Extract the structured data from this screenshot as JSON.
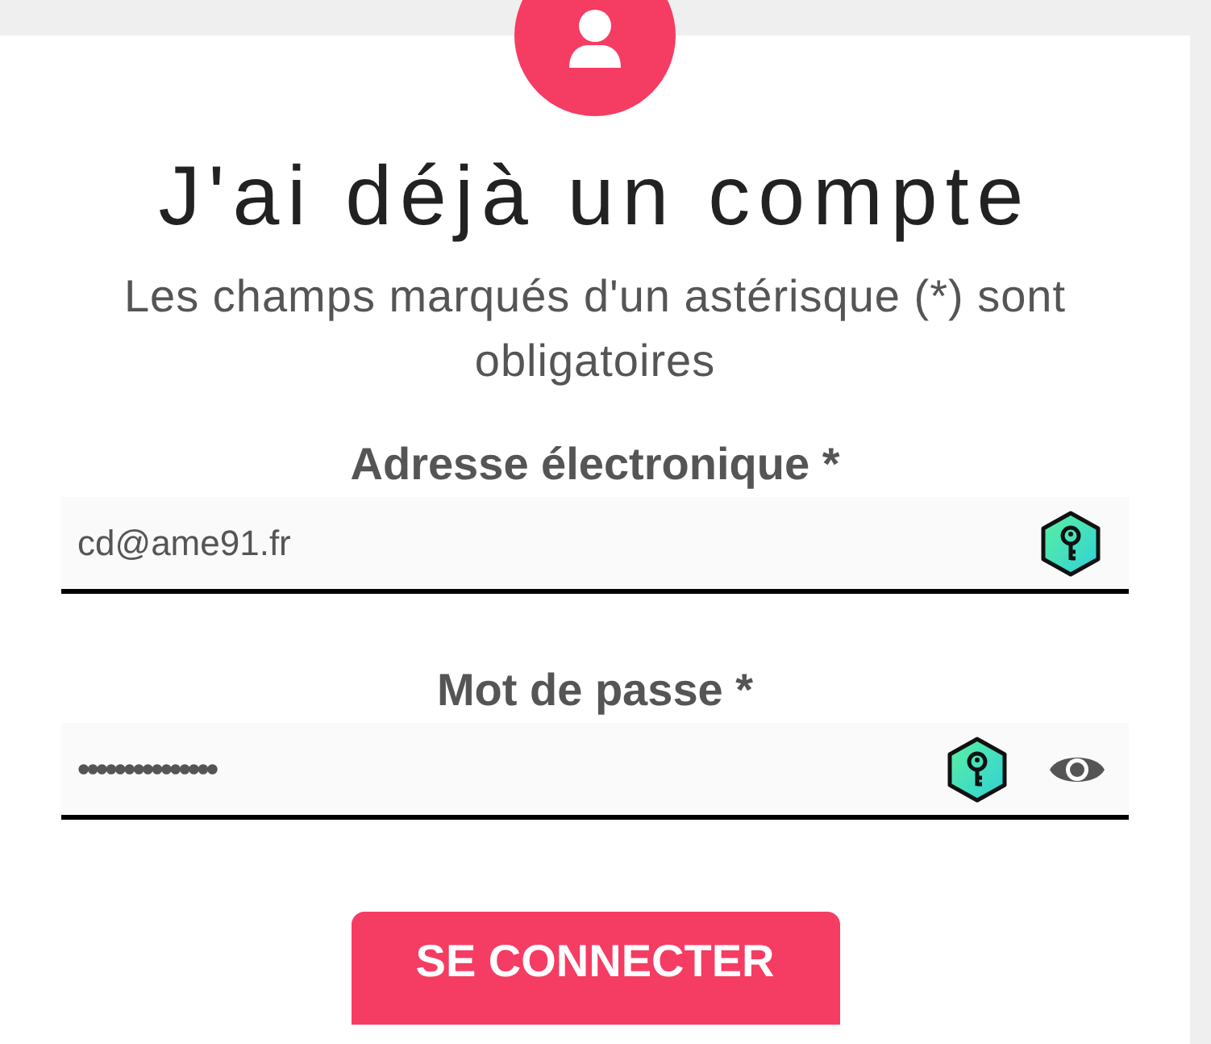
{
  "heading": "J'ai déjà un compte",
  "note": "Les champs marqués d'un astérisque (*) sont obligatoires",
  "fields": [
    {
      "kind": "email",
      "label": "Adresse électronique *",
      "value": "cd@ame91.fr"
    },
    {
      "kind": "password",
      "label": "Mot de passe *",
      "value": "•••••••••••••••"
    }
  ],
  "submit": "SE CONNECTER"
}
